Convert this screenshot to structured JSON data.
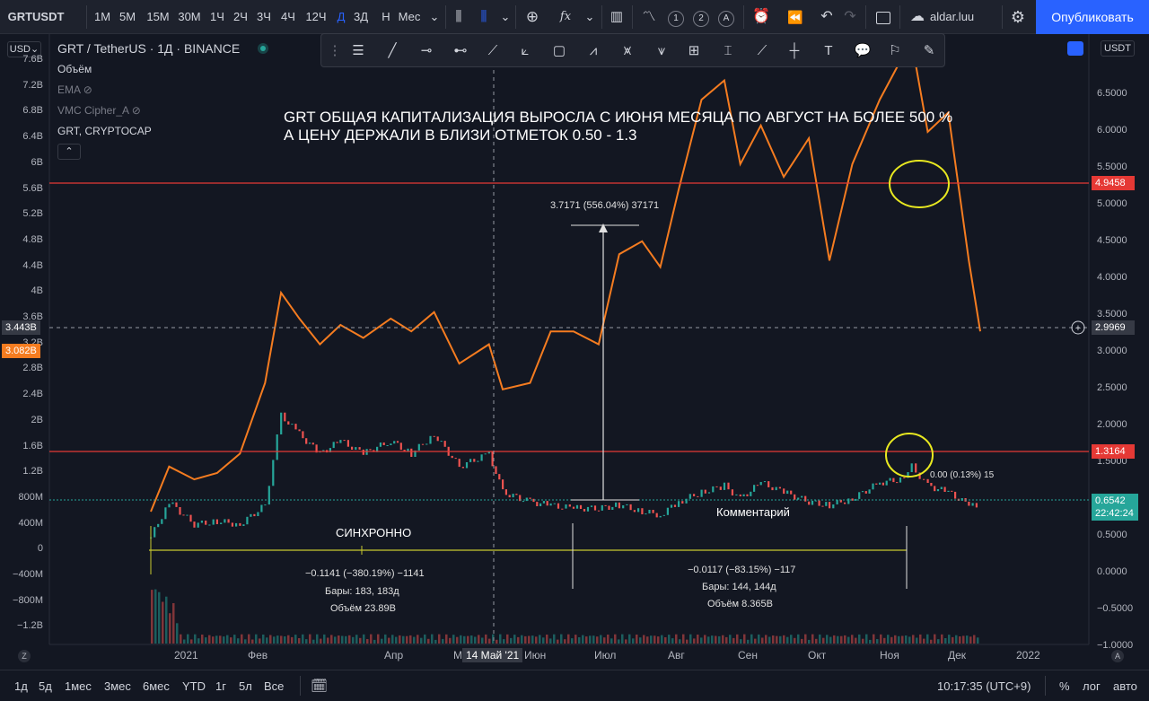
{
  "toolbar": {
    "symbol": "GRTUSDT",
    "intervals": [
      "1М",
      "5М",
      "15М",
      "30М",
      "1Ч",
      "2Ч",
      "3Ч",
      "4Ч",
      "12Ч",
      "Д",
      "3Д",
      "Н",
      "Мес"
    ],
    "active_interval": "Д",
    "user": "aldar.luu",
    "publish": "Опубликовать",
    "circles": [
      "1",
      "2",
      "A"
    ]
  },
  "header": {
    "currency": "USD",
    "symbol_title": "GRT / TetherUS · 1Д · BINANCE",
    "right_currency": "USDT"
  },
  "legend": [
    "Объём",
    "EMA",
    "VMC Cipher_A",
    "GRT, CRYPTOCAP"
  ],
  "annotation": {
    "line1": "GRT ОБЩАЯ КАПИТАЛИЗАЦИЯ ВЫРОСЛА С ИЮНЯ МЕСЯЦА ПО АВГУСТ НА БОЛЕЕ 500 %",
    "line2": "А ЦЕНУ ДЕРЖАЛИ В БЛИЗИ ОТМЕТОК 0.50 - 1.3"
  },
  "measure_top": "3.7171 (556.04%) 37171",
  "sync_label": "СИНХРОННО",
  "comment_label": "Комментарий",
  "measure1": {
    "line1": "−0.1141 (−380.19%) −1141",
    "line2": "Бары: 183, 183д",
    "line3": "Объём 23.89B"
  },
  "measure2": {
    "line1": "−0.0117 (−83.15%) −117",
    "line2": "Бары: 144, 144д",
    "line3": "Объём 8.365B"
  },
  "fib_overlap": "0.00 (0.13%) 15",
  "left_axis": [
    "7.6B",
    "7.2B",
    "6.8B",
    "6.4B",
    "6B",
    "5.6B",
    "5.2B",
    "4.8B",
    "4.4B",
    "4B",
    "3.6B",
    "3.2B",
    "2.8B",
    "2.4B",
    "2B",
    "1.6B",
    "1.2B",
    "800M",
    "400M",
    "0",
    "−400M",
    "−800M",
    "−1.2B"
  ],
  "left_tags": {
    "crosshair": "3.443B",
    "cap": "3.082B"
  },
  "right_axis": [
    "6.5000",
    "6.0000",
    "5.5000",
    "5.0000",
    "4.5000",
    "4.0000",
    "3.5000",
    "3.0000",
    "2.5000",
    "2.0000",
    "1.5000",
    "1.0000",
    "0.5000",
    "0.0000",
    "−0.5000",
    "−1.0000"
  ],
  "right_tags": {
    "level_top": "4.9458",
    "crosshair": "2.9969",
    "level_mid": "1.3164",
    "last_price": "0.6542",
    "countdown": "22:42:24"
  },
  "x_axis": [
    "2021",
    "Фев",
    "Апр",
    "М",
    "Июн",
    "Июл",
    "Авг",
    "Сен",
    "Окт",
    "Ноя",
    "Дек",
    "2022"
  ],
  "x_crosshair": "14 Май '21",
  "bottom": {
    "ranges": [
      "1д",
      "5д",
      "1мес",
      "3мес",
      "6мес",
      "YTD",
      "1г",
      "5л",
      "Все"
    ],
    "time": "10:17:35 (UTC+9)",
    "pct": "%",
    "log": "лог",
    "auto": "авто"
  },
  "colors": {
    "bg": "#131722",
    "price": "#f57c20",
    "level": "#e53935",
    "measure": "#c8c830",
    "blue": "#2962ff",
    "up": "#26a69a",
    "down": "#ef5350",
    "circle": "#e8e820"
  },
  "chart_data": {
    "type": "line",
    "series": [
      {
        "name": "GRT, CRYPTOCAP",
        "x": [
          "2020-12-17",
          "2020-12-25",
          "2021-01-05",
          "2021-01-15",
          "2021-01-25",
          "2021-02-05",
          "2021-02-12",
          "2021-02-20",
          "2021-03-01",
          "2021-03-10",
          "2021-03-20",
          "2021-04-01",
          "2021-04-10",
          "2021-04-20",
          "2021-05-01",
          "2021-05-14",
          "2021-05-20",
          "2021-06-01",
          "2021-06-10",
          "2021-06-20",
          "2021-07-01",
          "2021-07-10",
          "2021-07-20",
          "2021-07-28",
          "2021-08-05",
          "2021-08-15",
          "2021-08-25",
          "2021-09-01",
          "2021-09-10",
          "2021-09-20",
          "2021-10-01",
          "2021-10-10",
          "2021-10-20",
          "2021-11-01",
          "2021-11-10",
          "2021-11-15",
          "2021-11-22",
          "2021-12-01",
          "2021-12-10",
          "2021-12-15"
        ],
        "values": [
          0.6,
          1.3,
          1.1,
          1.2,
          1.5,
          2.6,
          4.0,
          3.6,
          3.2,
          3.5,
          3.3,
          3.6,
          3.4,
          3.7,
          2.9,
          3.2,
          2.5,
          2.6,
          3.4,
          3.4,
          3.2,
          4.6,
          4.8,
          4.4,
          5.6,
          7.0,
          7.3,
          6.0,
          6.6,
          5.8,
          6.4,
          4.5,
          6.0,
          7.0,
          7.6,
          7.9,
          6.5,
          6.8,
          4.5,
          3.4
        ]
      },
      {
        "name": "GRTUSDT",
        "x": [
          "2020-12-17",
          "2020-12-25",
          "2021-01-05",
          "2021-01-15",
          "2021-01-25",
          "2021-02-05",
          "2021-02-12",
          "2021-02-20",
          "2021-03-01",
          "2021-03-10",
          "2021-03-20",
          "2021-04-01",
          "2021-04-10",
          "2021-04-20",
          "2021-05-01",
          "2021-05-14",
          "2021-05-20",
          "2021-06-01",
          "2021-06-10",
          "2021-06-20",
          "2021-07-01",
          "2021-07-10",
          "2021-07-20",
          "2021-07-28",
          "2021-08-05",
          "2021-08-15",
          "2021-08-25",
          "2021-09-01",
          "2021-09-10",
          "2021-09-20",
          "2021-10-01",
          "2021-10-10",
          "2021-10-20",
          "2021-11-01",
          "2021-11-10",
          "2021-11-15",
          "2021-11-22",
          "2021-12-01",
          "2021-12-10",
          "2021-12-15"
        ],
        "values": [
          0.2,
          0.75,
          0.4,
          0.45,
          0.4,
          0.7,
          2.1,
          1.8,
          1.5,
          1.7,
          1.5,
          1.7,
          1.5,
          1.8,
          1.3,
          1.5,
          0.9,
          0.75,
          0.7,
          0.65,
          0.65,
          0.7,
          0.6,
          0.55,
          0.75,
          0.9,
          1.0,
          0.8,
          1.05,
          0.9,
          0.75,
          0.7,
          0.8,
          1.05,
          1.1,
          1.3,
          1.0,
          0.9,
          0.7,
          0.65
        ]
      }
    ],
    "ylim_left": [
      -1.3,
      7.7
    ],
    "ylim_right": [
      -1.15,
      6.65
    ],
    "hlines": [
      4.9458,
      1.3164
    ],
    "grid": false
  }
}
